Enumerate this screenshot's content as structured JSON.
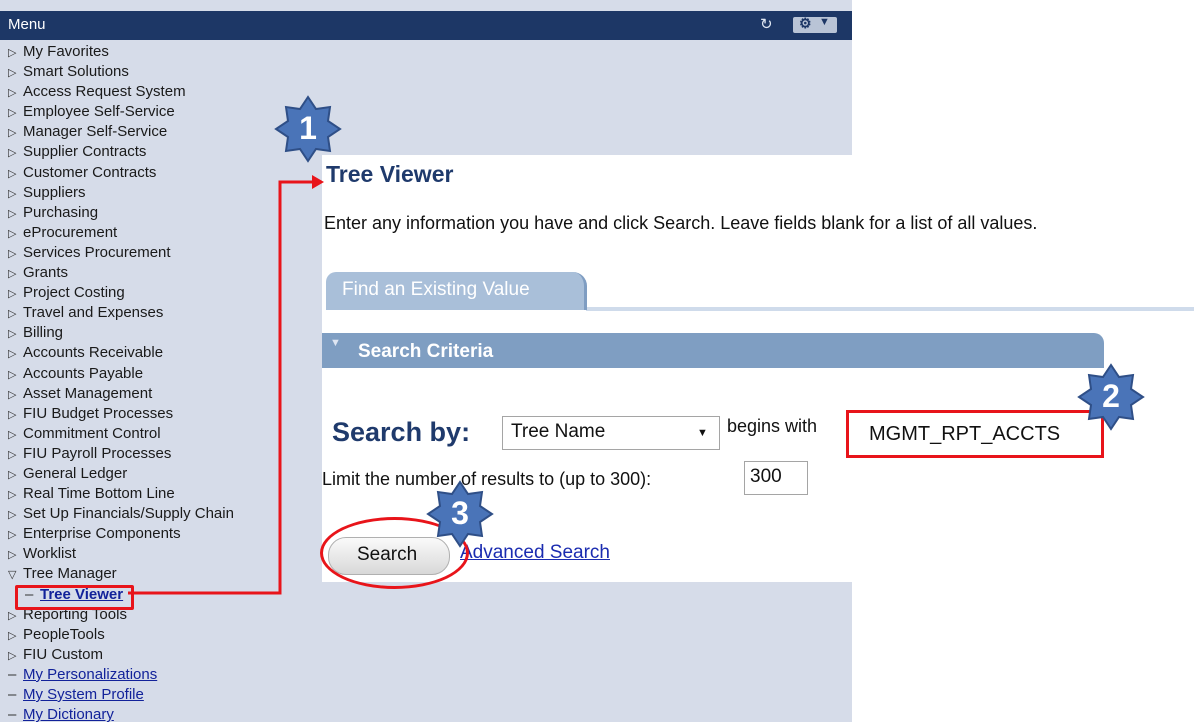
{
  "menu": {
    "title": "Menu",
    "refresh_icon": "refresh-icon",
    "settings_icon": "gear-icon",
    "items": [
      {
        "label": "My Favorites",
        "type": "folder"
      },
      {
        "label": "Smart Solutions",
        "type": "folder"
      },
      {
        "label": "Access Request System",
        "type": "folder"
      },
      {
        "label": "Employee Self-Service",
        "type": "folder"
      },
      {
        "label": "Manager Self-Service",
        "type": "folder"
      },
      {
        "label": "Supplier Contracts",
        "type": "folder"
      },
      {
        "label": "Customer Contracts",
        "type": "folder"
      },
      {
        "label": "Suppliers",
        "type": "folder"
      },
      {
        "label": "Purchasing",
        "type": "folder"
      },
      {
        "label": "eProcurement",
        "type": "folder"
      },
      {
        "label": "Services Procurement",
        "type": "folder"
      },
      {
        "label": "Grants",
        "type": "folder"
      },
      {
        "label": "Project Costing",
        "type": "folder"
      },
      {
        "label": "Travel and Expenses",
        "type": "folder"
      },
      {
        "label": "Billing",
        "type": "folder"
      },
      {
        "label": "Accounts Receivable",
        "type": "folder"
      },
      {
        "label": "Accounts Payable",
        "type": "folder"
      },
      {
        "label": "Asset Management",
        "type": "folder"
      },
      {
        "label": "FIU Budget Processes",
        "type": "folder"
      },
      {
        "label": "Commitment Control",
        "type": "folder"
      },
      {
        "label": "FIU Payroll Processes",
        "type": "folder"
      },
      {
        "label": "General Ledger",
        "type": "folder"
      },
      {
        "label": "Real Time Bottom Line",
        "type": "folder"
      },
      {
        "label": "Set Up Financials/Supply Chain",
        "type": "folder"
      },
      {
        "label": "Enterprise Components",
        "type": "folder"
      },
      {
        "label": "Worklist",
        "type": "folder"
      },
      {
        "label": "Tree Manager",
        "type": "open-folder"
      },
      {
        "label": "Tree Viewer",
        "type": "sub-link"
      },
      {
        "label": "Reporting Tools",
        "type": "folder"
      },
      {
        "label": "PeopleTools",
        "type": "folder"
      },
      {
        "label": "FIU Custom",
        "type": "folder"
      },
      {
        "label": "My Personalizations",
        "type": "link"
      },
      {
        "label": "My System Profile",
        "type": "link"
      },
      {
        "label": "My Dictionary",
        "type": "link"
      }
    ]
  },
  "page": {
    "title": "Tree Viewer",
    "instructions": "Enter any information you have and click Search. Leave fields blank for a list of all values.",
    "tab_label": "Find an Existing Value",
    "section_label": "Search Criteria",
    "search_by_label": "Search by:",
    "search_by_value": "Tree Name",
    "begins_with_label": "begins with",
    "tree_name_value": "MGMT_RPT_ACCTS",
    "limit_label": "Limit the number of results to (up to 300):",
    "limit_value": "300",
    "search_button": "Search",
    "advanced_search": "Advanced Search"
  },
  "annotations": {
    "steps": [
      "1",
      "2",
      "3"
    ],
    "color": "#e8141a",
    "badge_color": "#4a74b8"
  }
}
